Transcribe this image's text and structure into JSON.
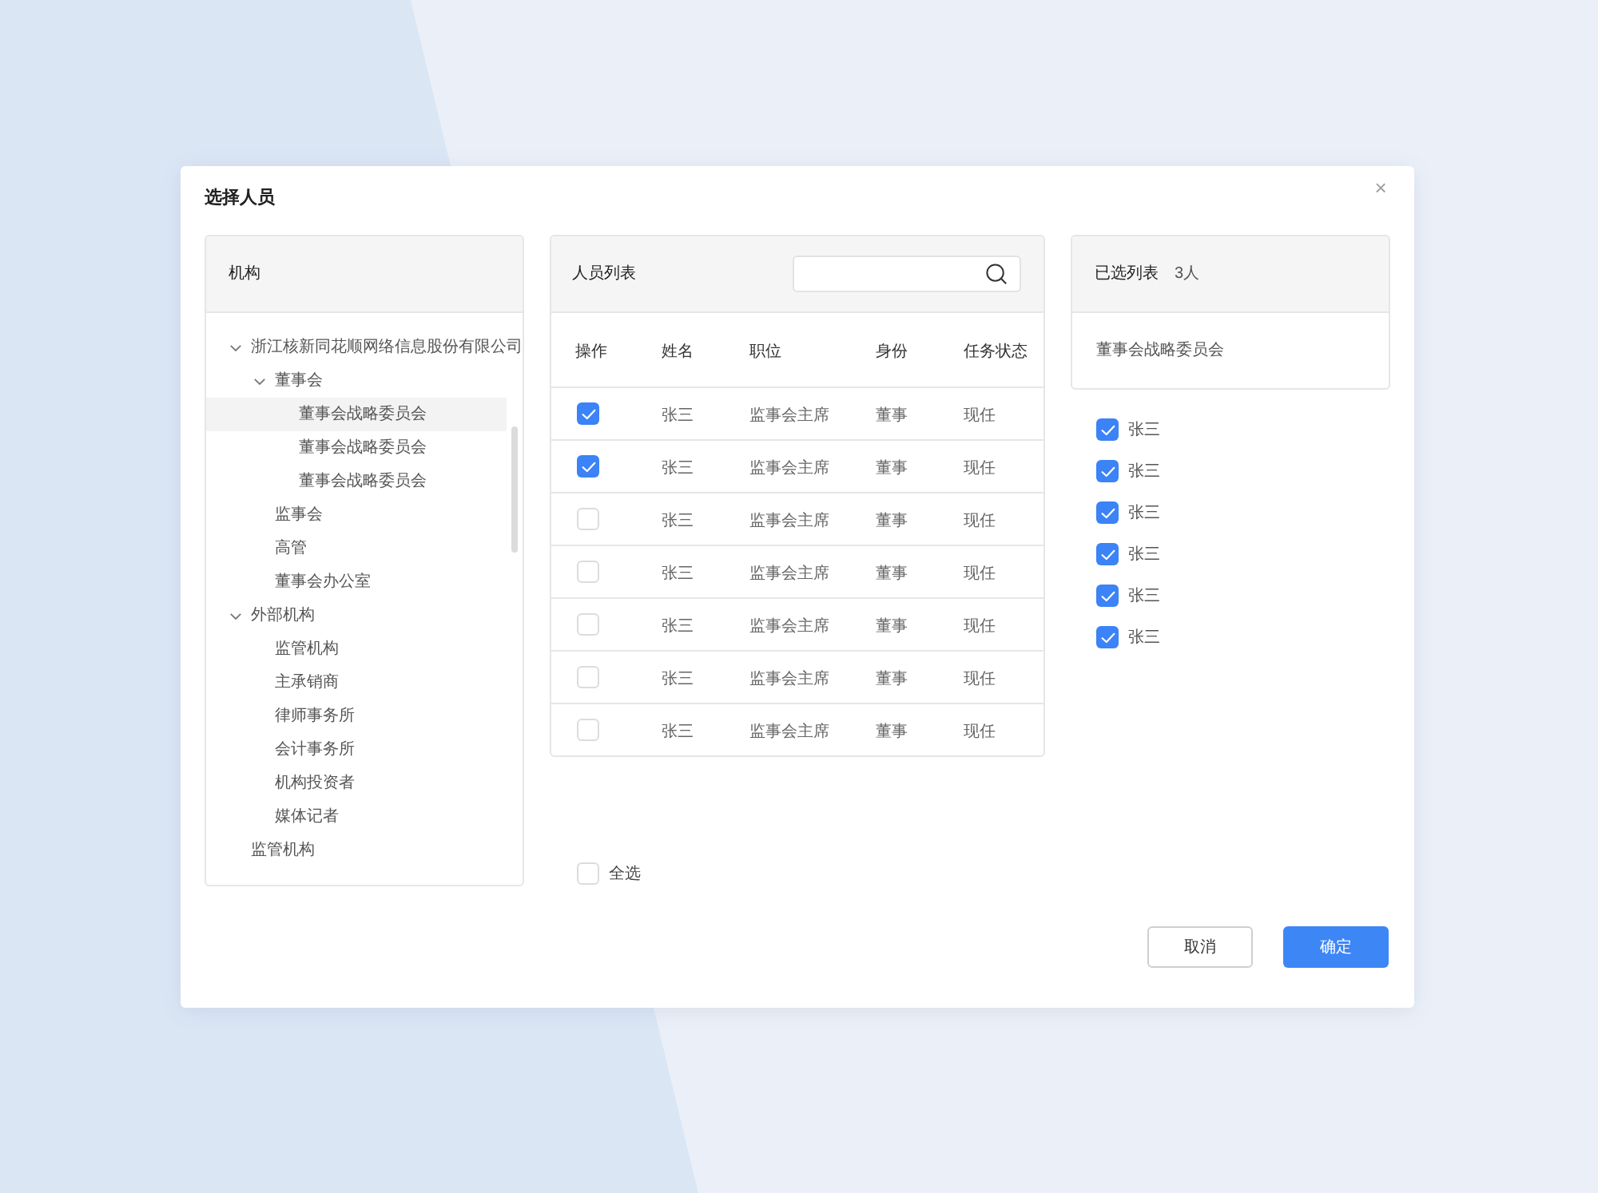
{
  "dialog": {
    "title": "选择人员",
    "close": "×"
  },
  "org_panel": {
    "title": "机构",
    "tree": [
      {
        "label": "浙江核新同花顺网络信息股份有限公司",
        "expanded": true,
        "selected": false,
        "children": [
          {
            "label": "董事会",
            "expanded": true,
            "selected": false,
            "children": [
              {
                "label": "董事会战略委员会",
                "selected": true
              },
              {
                "label": "董事会战略委员会",
                "selected": false
              },
              {
                "label": "董事会战略委员会",
                "selected": false
              }
            ]
          },
          {
            "label": "监事会",
            "selected": false
          },
          {
            "label": "高管",
            "selected": false
          },
          {
            "label": "董事会办公室",
            "selected": false
          }
        ]
      },
      {
        "label": "外部机构",
        "expanded": true,
        "selected": false,
        "children": [
          {
            "label": "监管机构",
            "selected": false
          },
          {
            "label": "主承销商",
            "selected": false
          },
          {
            "label": "律师事务所",
            "selected": false
          },
          {
            "label": "会计事务所",
            "selected": false
          },
          {
            "label": "机构投资者",
            "selected": false
          },
          {
            "label": "媒体记者",
            "selected": false
          }
        ]
      },
      {
        "label": "监管机构",
        "selected": false
      }
    ]
  },
  "people_panel": {
    "title": "人员列表",
    "table": {
      "columns": [
        "操作",
        "姓名",
        "职位",
        "身份",
        "任务状态"
      ],
      "rows": [
        {
          "checked": true,
          "cells": [
            "",
            "张三",
            "监事会主席",
            "董事",
            "现任"
          ]
        },
        {
          "checked": true,
          "cells": [
            "",
            "张三",
            "监事会主席",
            "董事",
            "现任"
          ]
        },
        {
          "checked": false,
          "cells": [
            "",
            "张三",
            "监事会主席",
            "董事",
            "现任"
          ]
        },
        {
          "checked": false,
          "cells": [
            "",
            "张三",
            "监事会主席",
            "董事",
            "现任"
          ]
        },
        {
          "checked": false,
          "cells": [
            "",
            "张三",
            "监事会主席",
            "董事",
            "现任"
          ]
        },
        {
          "checked": false,
          "cells": [
            "",
            "张三",
            "监事会主席",
            "董事",
            "现任"
          ]
        },
        {
          "checked": false,
          "cells": [
            "",
            "张三",
            "监事会主席",
            "董事",
            "现任"
          ]
        }
      ]
    },
    "select_all": {
      "label": "全选",
      "checked": false
    }
  },
  "selected_panel": {
    "title": "已选列表",
    "count": "3人",
    "group": "董事会战略委员会",
    "items": [
      {
        "label": "张三",
        "checked": true
      },
      {
        "label": "张三",
        "checked": true
      },
      {
        "label": "张三",
        "checked": true
      },
      {
        "label": "张三",
        "checked": true
      },
      {
        "label": "张三",
        "checked": true
      },
      {
        "label": "张三",
        "checked": true
      }
    ]
  },
  "buttons": [
    {
      "label": "取消",
      "kind": "secondary"
    },
    {
      "label": "确定",
      "kind": "primary"
    }
  ]
}
